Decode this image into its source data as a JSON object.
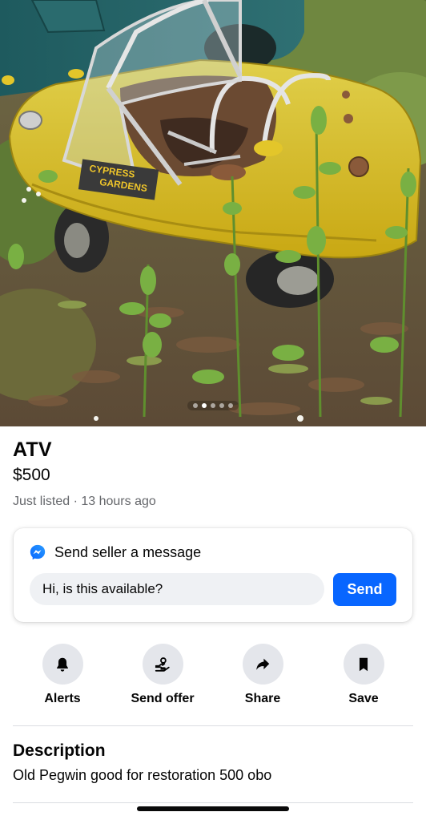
{
  "photo": {
    "sticker_text": [
      "CYPRESS",
      "GARDENS"
    ],
    "pager": {
      "count": 5,
      "active_index": 1
    }
  },
  "listing": {
    "title": "ATV",
    "price": "$500",
    "listed_text": "Just listed · 13 hours ago"
  },
  "message_card": {
    "icon": "messenger-icon",
    "heading": "Send seller a message",
    "input_value": "Hi, is this available?",
    "send_label": "Send",
    "accent_color": "#0866ff"
  },
  "actions": [
    {
      "label": "Alerts",
      "icon": "bell-icon"
    },
    {
      "label": "Send offer",
      "icon": "offer-icon"
    },
    {
      "label": "Share",
      "icon": "share-icon"
    },
    {
      "label": "Save",
      "icon": "bookmark-icon"
    }
  ],
  "description": {
    "heading": "Description",
    "text": "Old Pegwin good for restoration 500 obo"
  }
}
